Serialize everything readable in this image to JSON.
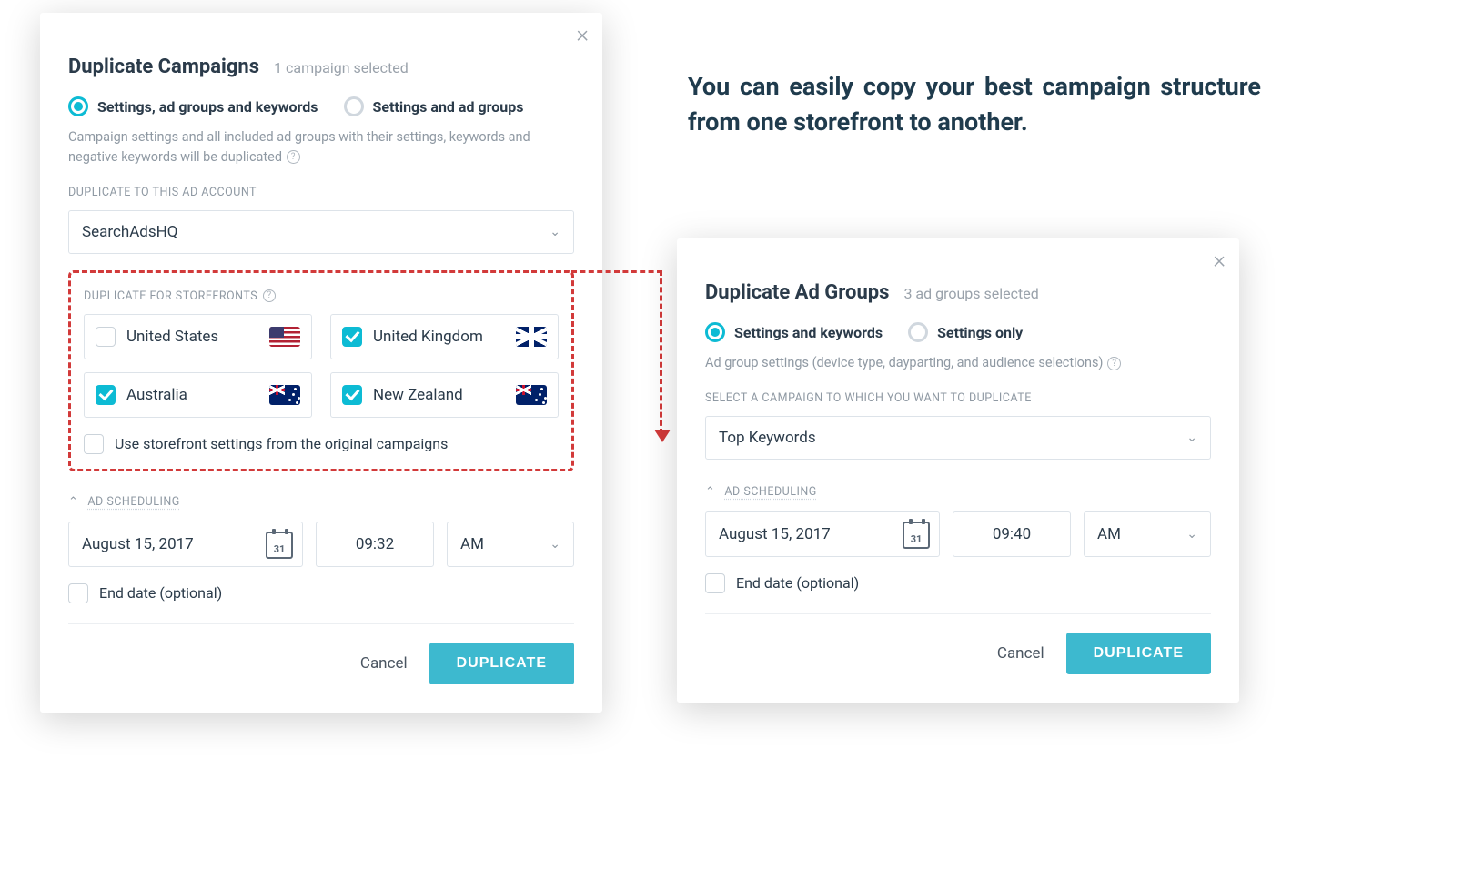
{
  "caption": "You can easily copy your best campaign structure from one storefront to another.",
  "dialog1": {
    "title": "Duplicate Campaigns",
    "subtitle": "1 campaign selected",
    "radio_options": {
      "opt_a": "Settings, ad groups and keywords",
      "opt_b": "Settings and ad groups"
    },
    "description": "Campaign settings and all included ad groups with their settings, keywords and negative keywords will be duplicated",
    "account_label": "DUPLICATE TO THIS AD ACCOUNT",
    "account_value": "SearchAdsHQ",
    "storefronts_label": "DUPLICATE FOR STOREFRONTS",
    "storefronts": [
      {
        "name": "United States",
        "checked": false,
        "flag": "us"
      },
      {
        "name": "United Kingdom",
        "checked": true,
        "flag": "uk"
      },
      {
        "name": "Australia",
        "checked": true,
        "flag": "au"
      },
      {
        "name": "New Zealand",
        "checked": true,
        "flag": "nz"
      }
    ],
    "use_original_settings": "Use storefront settings from the original campaigns",
    "use_original_checked": false,
    "schedule_label": "AD SCHEDULING",
    "date": "August 15, 2017",
    "cal_day": "31",
    "time": "09:32",
    "ampm": "AM",
    "end_date_label": "End date (optional)",
    "end_date_checked": false,
    "cancel": "Cancel",
    "confirm": "DUPLICATE"
  },
  "dialog2": {
    "title": "Duplicate Ad Groups",
    "subtitle": "3 ad groups selected",
    "radio_options": {
      "opt_a": "Settings and keywords",
      "opt_b": "Settings only"
    },
    "description": "Ad group settings (device type, dayparting, and audience selections)",
    "campaign_label": "SELECT A CAMPAIGN TO WHICH YOU WANT TO DUPLICATE",
    "campaign_value": "Top Keywords",
    "schedule_label": "AD SCHEDULING",
    "date": "August 15, 2017",
    "cal_day": "31",
    "time": "09:40",
    "ampm": "AM",
    "end_date_label": "End date (optional)",
    "end_date_checked": false,
    "cancel": "Cancel",
    "confirm": "DUPLICATE"
  }
}
